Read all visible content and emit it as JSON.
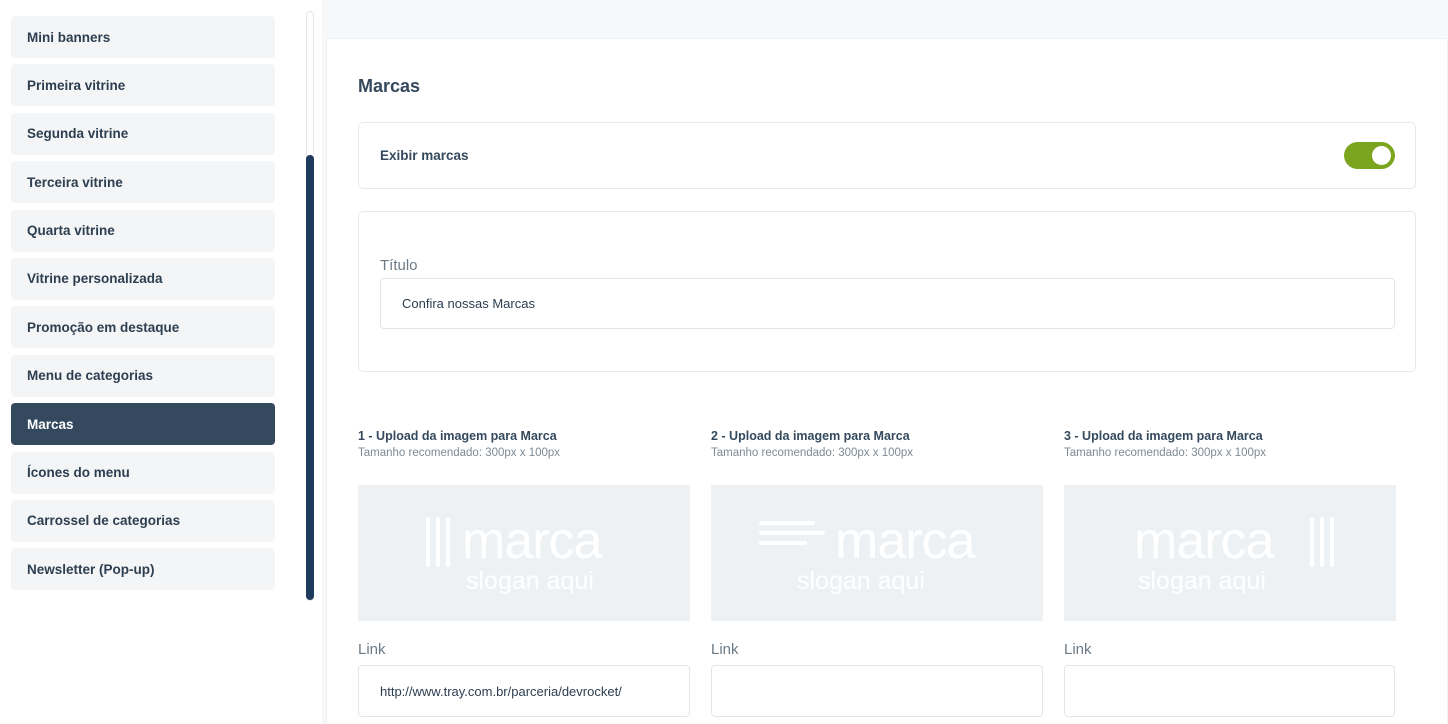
{
  "sidebar": {
    "items": [
      {
        "label": "Mini banners"
      },
      {
        "label": "Primeira vitrine"
      },
      {
        "label": "Segunda vitrine"
      },
      {
        "label": "Terceira vitrine"
      },
      {
        "label": "Quarta vitrine"
      },
      {
        "label": "Vitrine personalizada"
      },
      {
        "label": "Promoção em destaque"
      },
      {
        "label": "Menu de categorias"
      },
      {
        "label": "Marcas"
      },
      {
        "label": "Ícones do menu"
      },
      {
        "label": "Carrossel de categorias"
      },
      {
        "label": "Newsletter (Pop-up)"
      }
    ],
    "active_item": "Marcas"
  },
  "main": {
    "section_title": "Marcas",
    "toggle": {
      "label": "Exibir marcas",
      "state": "on",
      "color": "#7ba51e"
    },
    "title_field": {
      "label": "Título",
      "value": "Confira nossas Marcas"
    },
    "uploads": [
      {
        "heading": "1 - Upload da imagem para Marca",
        "hint": "Tamanho recomendado: 300px x 100px",
        "preview_brand": "marca",
        "preview_slogan": "slogan aqui",
        "link_label": "Link",
        "link_value": "http://www.tray.com.br/parceria/devrocket/"
      },
      {
        "heading": "2 - Upload da imagem para Marca",
        "hint": "Tamanho recomendado: 300px x 100px",
        "preview_brand": "marca",
        "preview_slogan": "slogan aqui",
        "link_label": "Link",
        "link_value": ""
      },
      {
        "heading": "3 - Upload da imagem para Marca",
        "hint": "Tamanho recomendado: 300px x 100px",
        "preview_brand": "marca",
        "preview_slogan": "slogan aqui",
        "link_label": "Link",
        "link_value": ""
      }
    ]
  },
  "colors": {
    "sidebar_active_bg": "#34495e",
    "scroll_thumb": "#1e3a5c",
    "toggle_on": "#7ba51e"
  }
}
